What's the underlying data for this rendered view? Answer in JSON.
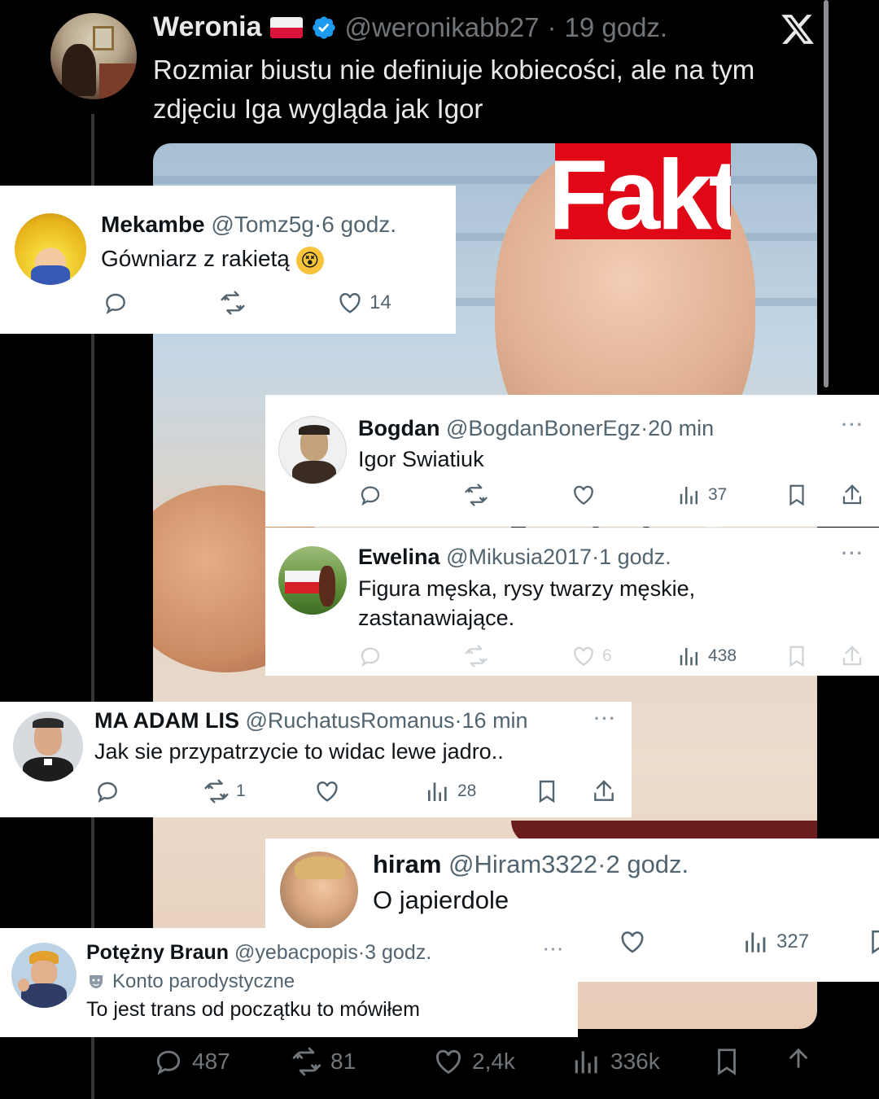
{
  "base_tweet": {
    "name": "Weronia",
    "handle": "@weronikabb27",
    "time": "19 godz.",
    "text": "Rozmiar biustu nie definiuje kobiecości, ale na tym zdjęciu Iga wygląda jak Igor",
    "media_watermark": "Fakt",
    "stats": {
      "replies": "487",
      "retweets": "81",
      "likes": "2,4k",
      "views": "336k"
    },
    "icons": [
      "flag-poland-icon",
      "verified-badge-icon",
      "x-logo-icon",
      "reply-icon",
      "retweet-icon",
      "like-icon",
      "views-icon",
      "bookmark-icon",
      "share-icon"
    ]
  },
  "replies": [
    {
      "id": "mekambe",
      "name": "Mekambe",
      "handle": "@Tomz5g",
      "time": "6 godz.",
      "text": "Gówniarz z rakietą",
      "emoji": "😵",
      "likes": "14"
    },
    {
      "id": "bogdan",
      "name": "Bogdan",
      "handle": "@BogdanBonerEgz",
      "time": "20 min",
      "text": "Igor Swiatiuk",
      "views": "37",
      "more": "···"
    },
    {
      "id": "ewelina",
      "name": "Ewelina",
      "handle": "@Mikusia2017",
      "time": "1 godz.",
      "text": "Figura męska, rysy twarzy męskie, zastanawiające.",
      "likes": "6",
      "views": "438",
      "more": "···"
    },
    {
      "id": "adam",
      "name": "MA ADAM LIS",
      "handle": "@RuchatusRomanus",
      "time": "16 min",
      "text": "Jak sie przypatrzycie to widac lewe jadro..",
      "retweets": "1",
      "views": "28",
      "more": "···"
    },
    {
      "id": "hiram",
      "name": "hiram",
      "handle": "@Hiram3322",
      "time": "2 godz.",
      "text": "O japierdole",
      "views": "327"
    },
    {
      "id": "braun",
      "name": "Potężny Braun",
      "handle": "@yebacpopis",
      "time": "3 godz.",
      "label": "Konto parodystyczne",
      "text": "To jest trans od początku to mówiłem",
      "more": "···"
    }
  ],
  "separator": "·",
  "colors": {
    "dark_bg": "#000000",
    "light_bg": "#ffffff",
    "verified_blue": "#1d9bf0",
    "fakt_red": "#e00716"
  }
}
